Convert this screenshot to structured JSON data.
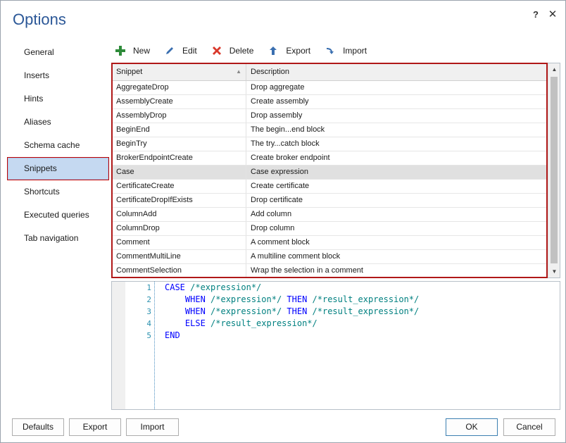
{
  "window": {
    "title": "Options",
    "help_label": "?",
    "close_label": "✕"
  },
  "nav": {
    "items": [
      {
        "label": "General"
      },
      {
        "label": "Inserts"
      },
      {
        "label": "Hints"
      },
      {
        "label": "Aliases"
      },
      {
        "label": "Schema cache"
      },
      {
        "label": "Snippets",
        "active": true
      },
      {
        "label": "Shortcuts"
      },
      {
        "label": "Executed queries"
      },
      {
        "label": "Tab navigation"
      }
    ]
  },
  "toolbar": {
    "new_label": "New",
    "edit_label": "Edit",
    "delete_label": "Delete",
    "export_label": "Export",
    "import_label": "Import"
  },
  "colors": {
    "accent": "#2b5797",
    "highlight_border": "#b01818",
    "selected_nav": "#c5d9f1",
    "keyword": "#0000ff",
    "comment": "#008080"
  },
  "grid": {
    "headers": {
      "snippet": "Snippet",
      "description": "Description"
    },
    "selected_row": 6,
    "rows": [
      {
        "snippet": "AggregateDrop",
        "description": "Drop aggregate"
      },
      {
        "snippet": "AssemblyCreate",
        "description": "Create assembly"
      },
      {
        "snippet": "AssemblyDrop",
        "description": "Drop assembly"
      },
      {
        "snippet": "BeginEnd",
        "description": "The begin...end block"
      },
      {
        "snippet": "BeginTry",
        "description": "The try...catch block"
      },
      {
        "snippet": "BrokerEndpointCreate",
        "description": "Create broker endpoint"
      },
      {
        "snippet": "Case",
        "description": "Case expression"
      },
      {
        "snippet": "CertificateCreate",
        "description": "Create certificate"
      },
      {
        "snippet": "CertificateDropIfExists",
        "description": "Drop certificate"
      },
      {
        "snippet": "ColumnAdd",
        "description": "Add column"
      },
      {
        "snippet": "ColumnDrop",
        "description": "Drop column"
      },
      {
        "snippet": "Comment",
        "description": "A comment block"
      },
      {
        "snippet": "CommentMultiLine",
        "description": "A multiline comment block"
      },
      {
        "snippet": "CommentSelection",
        "description": "Wrap the selection in a comment"
      }
    ]
  },
  "editor": {
    "line_numbers": [
      "1",
      "2",
      "3",
      "4",
      "5"
    ],
    "lines": [
      {
        "kw1": "CASE",
        "c1": " /*expression*/",
        "kw2": "",
        "c2": ""
      },
      {
        "kw1": "    WHEN",
        "c1": " /*expression*/",
        "kw2": " THEN",
        "c2": " /*result_expression*/"
      },
      {
        "kw1": "    WHEN",
        "c1": " /*expression*/",
        "kw2": " THEN",
        "c2": " /*result_expression*/"
      },
      {
        "kw1": "    ELSE",
        "c1": " /*result_expression*/",
        "kw2": "",
        "c2": ""
      },
      {
        "kw1": "END",
        "c1": "",
        "kw2": "",
        "c2": ""
      }
    ]
  },
  "footer": {
    "defaults_label": "Defaults",
    "export_label": "Export",
    "import_label": "Import",
    "ok_label": "OK",
    "cancel_label": "Cancel"
  }
}
